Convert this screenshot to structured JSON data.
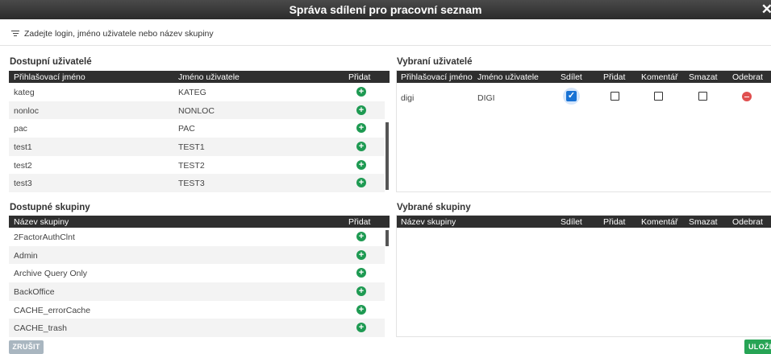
{
  "dialog": {
    "title": "Správa sdílení pro pracovní seznam",
    "close_glyph": "✕"
  },
  "filter": {
    "placeholder": "Zadejte login, jméno uživatele nebo název skupiny",
    "icon": "filter-icon"
  },
  "available_users": {
    "title": "Dostupní uživatelé",
    "columns": {
      "login": "Přihlašovací jméno",
      "name": "Jméno uživatele",
      "add": "Přidat"
    },
    "rows": [
      {
        "login": "kateg",
        "name": "KATEG"
      },
      {
        "login": "nonloc",
        "name": "NONLOC"
      },
      {
        "login": "pac",
        "name": "PAC"
      },
      {
        "login": "test1",
        "name": "TEST1"
      },
      {
        "login": "test2",
        "name": "TEST2"
      },
      {
        "login": "test3",
        "name": "TEST3"
      }
    ]
  },
  "selected_users": {
    "title": "Vybraní uživatelé",
    "columns": {
      "login": "Přihlašovací jméno",
      "name": "Jméno uživatele",
      "share": "Sdílet",
      "add": "Přidat",
      "comment": "Komentář",
      "delete": "Smazat",
      "remove": "Odebrat"
    },
    "rows": [
      {
        "login": "digi",
        "name": "DIGI",
        "share": true,
        "add": false,
        "comment": false,
        "delete": false
      }
    ]
  },
  "available_groups": {
    "title": "Dostupné skupiny",
    "columns": {
      "name": "Název skupiny",
      "add": "Přidat"
    },
    "rows": [
      {
        "name": "2FactorAuthClnt"
      },
      {
        "name": "Admin"
      },
      {
        "name": "Archive Query Only"
      },
      {
        "name": "BackOffice"
      },
      {
        "name": "CACHE_errorCache"
      },
      {
        "name": "CACHE_trash"
      }
    ]
  },
  "selected_groups": {
    "title": "Vybrané skupiny",
    "columns": {
      "name": "Název skupiny",
      "share": "Sdílet",
      "add": "Přidat",
      "comment": "Komentář",
      "delete": "Smazat",
      "remove": "Odebrat"
    },
    "rows": []
  },
  "footer": {
    "cancel_label": "ZRUŠIT",
    "save_label": "ULOŽIT"
  },
  "colors": {
    "header_bg": "#2f2f2f",
    "add": "#1e9a52",
    "remove": "#e04f4f",
    "checkbox_on": "#1872d4",
    "save": "#27a455",
    "cancel": "#a9b6c0"
  }
}
